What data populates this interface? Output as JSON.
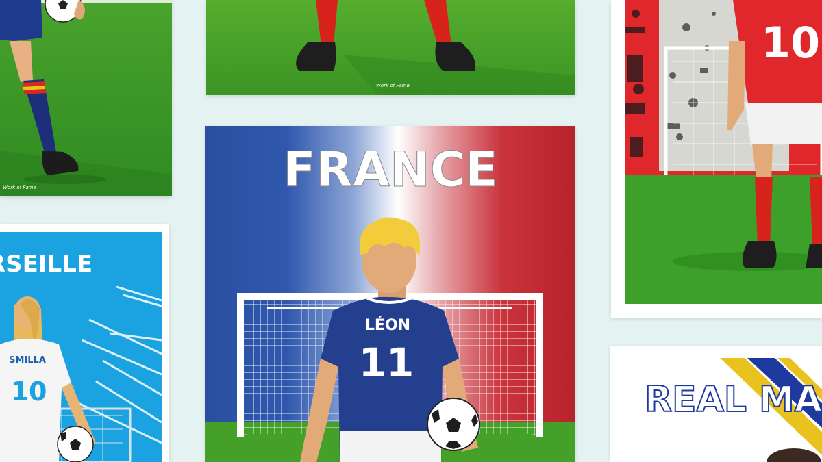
{
  "posters": {
    "spain": {
      "signature": "Work of Fame"
    },
    "top_center": {
      "signature": "Work of Fame"
    },
    "france": {
      "title": "FRANCE",
      "player_name": "LÉON",
      "player_number": "11"
    },
    "marseille": {
      "title": "RSEILLE",
      "player_name": "SMILLA",
      "player_number": "10"
    },
    "switzerland": {
      "player_number": "10"
    },
    "real": {
      "title": "REAL MA"
    }
  },
  "colors": {
    "background": "#e4f2f2",
    "france_blue": "#2a4fa0",
    "france_red": "#c0252e",
    "pitch_green": "#3c9a2a",
    "marseille_blue": "#1aa3e0",
    "swiss_red": "#e0282c",
    "real_yellow": "#e9c21e",
    "real_blue": "#1e3a9e"
  }
}
